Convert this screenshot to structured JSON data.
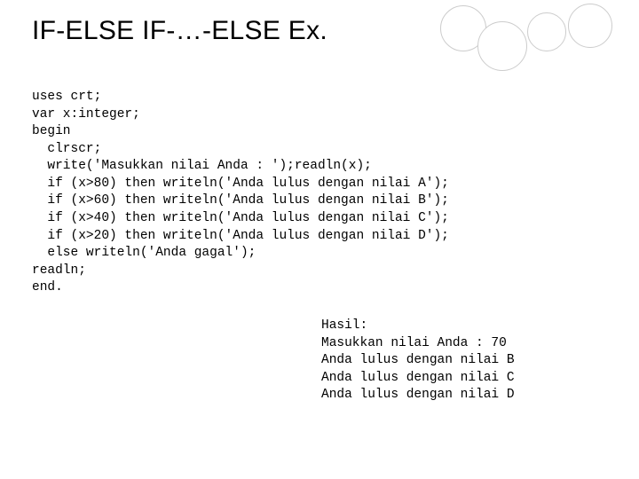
{
  "title": "IF-ELSE IF-…-ELSE Ex.",
  "code": {
    "l1": "uses crt;",
    "l2": "var x:integer;",
    "l3": "begin",
    "l4": "  clrscr;",
    "l5": "  write('Masukkan nilai Anda : ');readln(x);",
    "l6": "  if (x>80) then writeln('Anda lulus dengan nilai A');",
    "l7": "  if (x>60) then writeln('Anda lulus dengan nilai B');",
    "l8": "  if (x>40) then writeln('Anda lulus dengan nilai C');",
    "l9": "  if (x>20) then writeln('Anda lulus dengan nilai D');",
    "l10": "  else writeln('Anda gagal');",
    "l11": "readln;",
    "l12": "end."
  },
  "result": {
    "label": "Hasil:",
    "r1": "Masukkan nilai Anda : 70",
    "r2": "Anda lulus dengan nilai B",
    "r3": "Anda lulus dengan nilai C",
    "r4": "Anda lulus dengan nilai D"
  }
}
